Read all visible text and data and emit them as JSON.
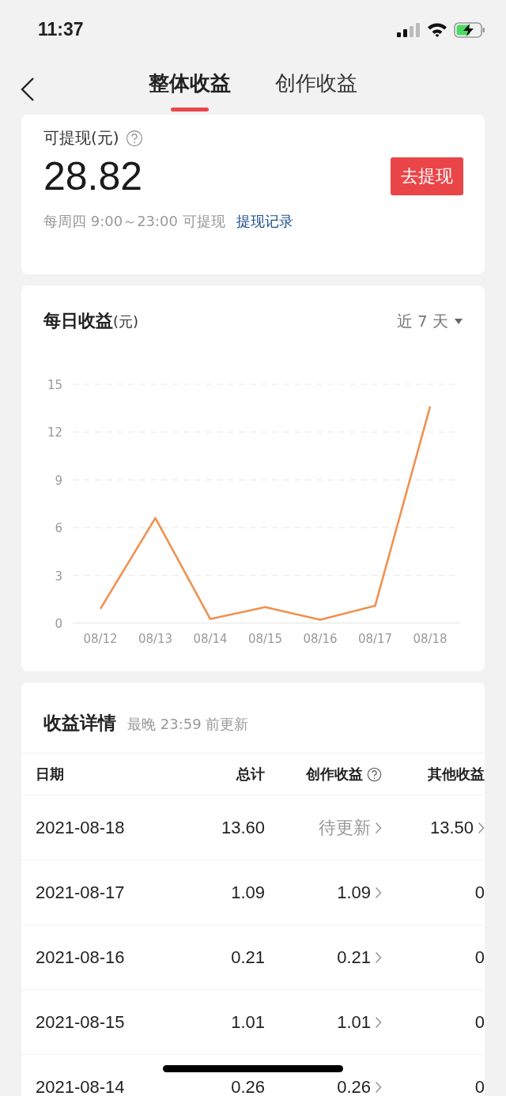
{
  "status_bar": {
    "time": "11:37"
  },
  "tabs": [
    {
      "label": "整体收益",
      "selected": true
    },
    {
      "label": "创作收益",
      "selected": false
    }
  ],
  "withdraw": {
    "label": "可提现(元)",
    "amount": "28.82",
    "button": "去提现",
    "note": "每周四 9:00～23:00 可提现",
    "link": "提现记录"
  },
  "daily": {
    "title": "每日收益",
    "unit": "(元)",
    "range": "近 7 天",
    "chart_data": {
      "type": "line",
      "categories": [
        "08/12",
        "08/13",
        "08/14",
        "08/15",
        "08/16",
        "08/17",
        "08/18"
      ],
      "grid": true,
      "ylim": [
        0,
        15
      ],
      "yticks": [
        0,
        3,
        6,
        9,
        12,
        15
      ],
      "series": [
        {
          "color": "#ef9150",
          "values": [
            0.9,
            6.6,
            0.26,
            1.01,
            0.21,
            1.09,
            13.6
          ]
        }
      ]
    }
  },
  "details": {
    "title": "收益详情",
    "note": "最晚 23:59 前更新",
    "columns": [
      "日期",
      "总计",
      "创作收益",
      "其他收益"
    ],
    "rows": [
      {
        "date": "2021-08-18",
        "total": "13.60",
        "creative": "待更新",
        "pending": true,
        "other": "13.50",
        "other_link": true
      },
      {
        "date": "2021-08-17",
        "total": "1.09",
        "creative": "1.09",
        "pending": false,
        "other": "0",
        "other_link": false
      },
      {
        "date": "2021-08-16",
        "total": "0.21",
        "creative": "0.21",
        "pending": false,
        "other": "0",
        "other_link": false
      },
      {
        "date": "2021-08-15",
        "total": "1.01",
        "creative": "1.01",
        "pending": false,
        "other": "0",
        "other_link": false
      },
      {
        "date": "2021-08-14",
        "total": "0.26",
        "creative": "0.26",
        "pending": false,
        "other": "0",
        "other_link": false
      }
    ]
  }
}
